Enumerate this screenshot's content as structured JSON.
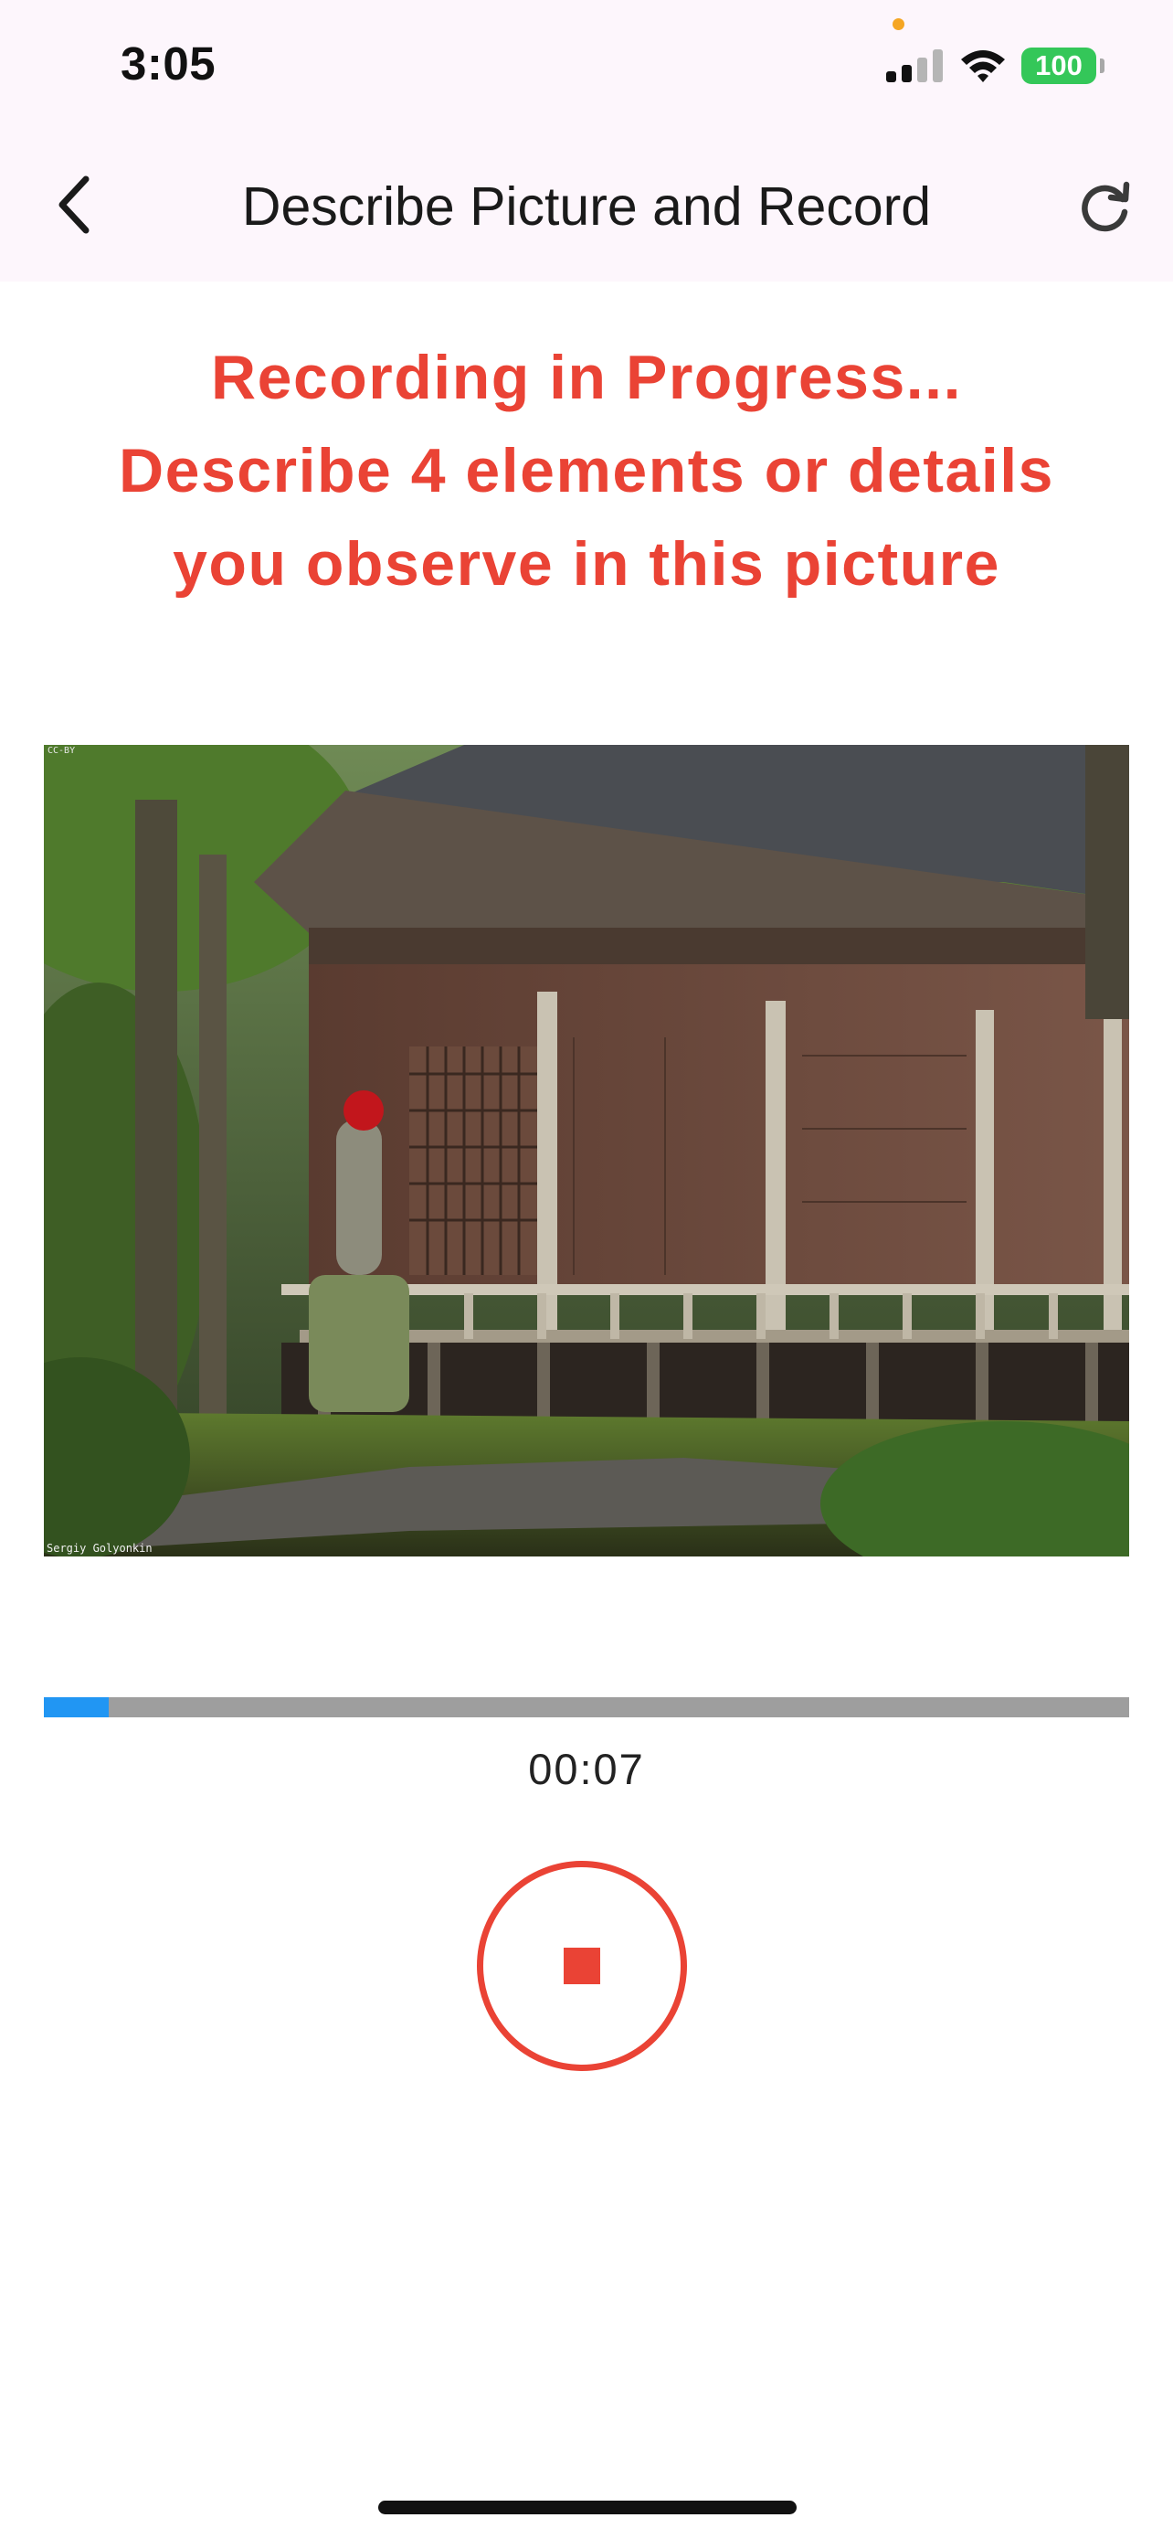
{
  "status_bar": {
    "time": "3:05",
    "battery": "100",
    "icons": [
      "signal-icon",
      "wifi-icon",
      "battery-icon"
    ]
  },
  "nav": {
    "title": "Describe Picture and Record",
    "back_icon": "chevron-left-icon",
    "refresh_icon": "refresh-icon"
  },
  "instruction": {
    "line1": "Recording in Progress...",
    "line2": "Describe 4 elements or details",
    "line3": "you observe in this picture",
    "color": "#ea4335"
  },
  "picture": {
    "credit_top": "CC-BY",
    "credit_bottom": "Sergiy Golyonkin"
  },
  "progress": {
    "fraction": 0.06,
    "track_color": "#9e9e9e",
    "fill_color": "#2196f3"
  },
  "timer": "00:07",
  "stop_button": {
    "icon": "stop-icon",
    "color": "#ea4335"
  }
}
